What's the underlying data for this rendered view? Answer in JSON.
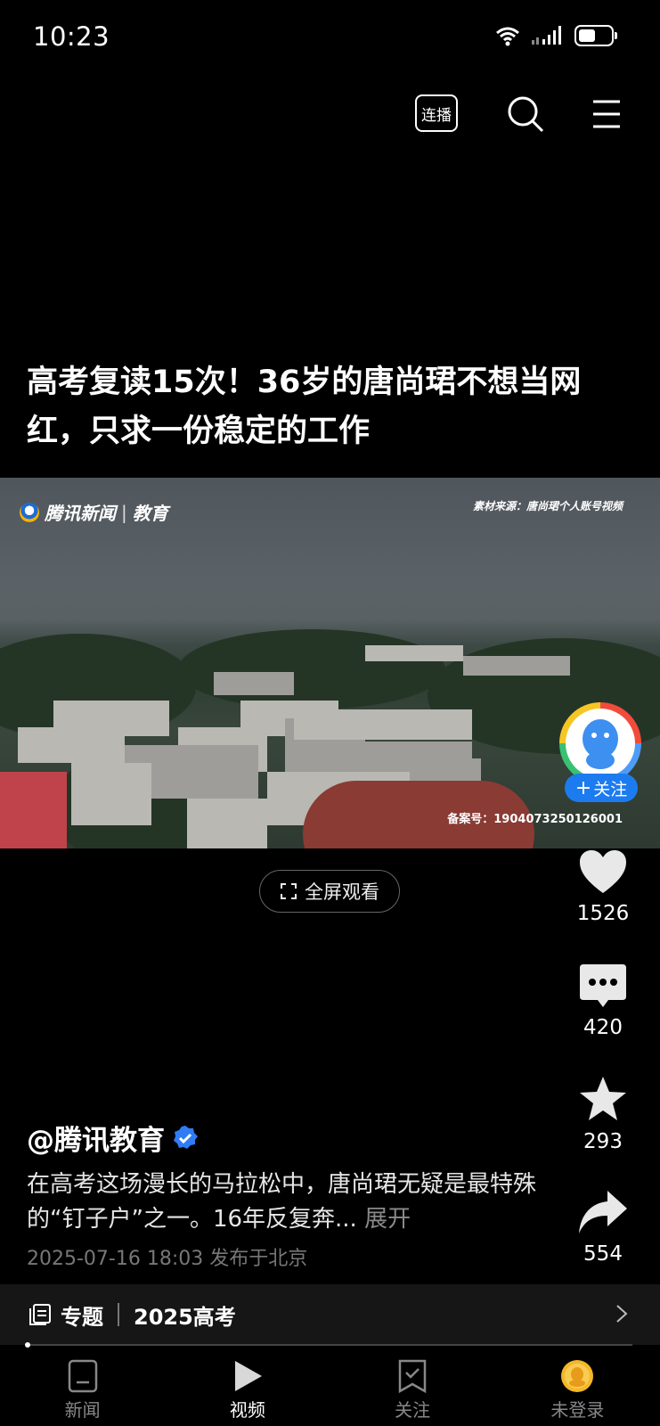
{
  "status_bar": {
    "time": "10:23"
  },
  "toolbar": {
    "autoplay_label": "连播"
  },
  "video": {
    "title": "高考复读15次！36岁的唐尚珺不想当网红，只求一份稳定的工作",
    "brand": "腾讯新闻",
    "channel": "教育",
    "source_note": "素材来源：唐尚珺个人账号视频",
    "record_no": "备案号：1904073250126001",
    "fullscreen_label": "全屏观看",
    "progress_fraction": 0.0
  },
  "side_actions": {
    "follow_label": "关注",
    "likes": "1526",
    "comments": "420",
    "favorites": "293",
    "shares": "554"
  },
  "post": {
    "author": "@腾讯教育",
    "description": "在高考这场漫长的马拉松中，唐尚珺无疑是最特殊的“钉子户”之一。16年反复奔...",
    "expand_label": "展开",
    "meta": "2025-07-16 18:03 发布于北京"
  },
  "topic": {
    "label": "专题",
    "title": "2025高考"
  },
  "bottom_nav": [
    {
      "label": "新闻",
      "icon": "news-icon"
    },
    {
      "label": "视频",
      "icon": "video-play-icon"
    },
    {
      "label": "关注",
      "icon": "follow-bookmark-icon"
    },
    {
      "label": "未登录",
      "icon": "user-avatar-icon"
    }
  ]
}
